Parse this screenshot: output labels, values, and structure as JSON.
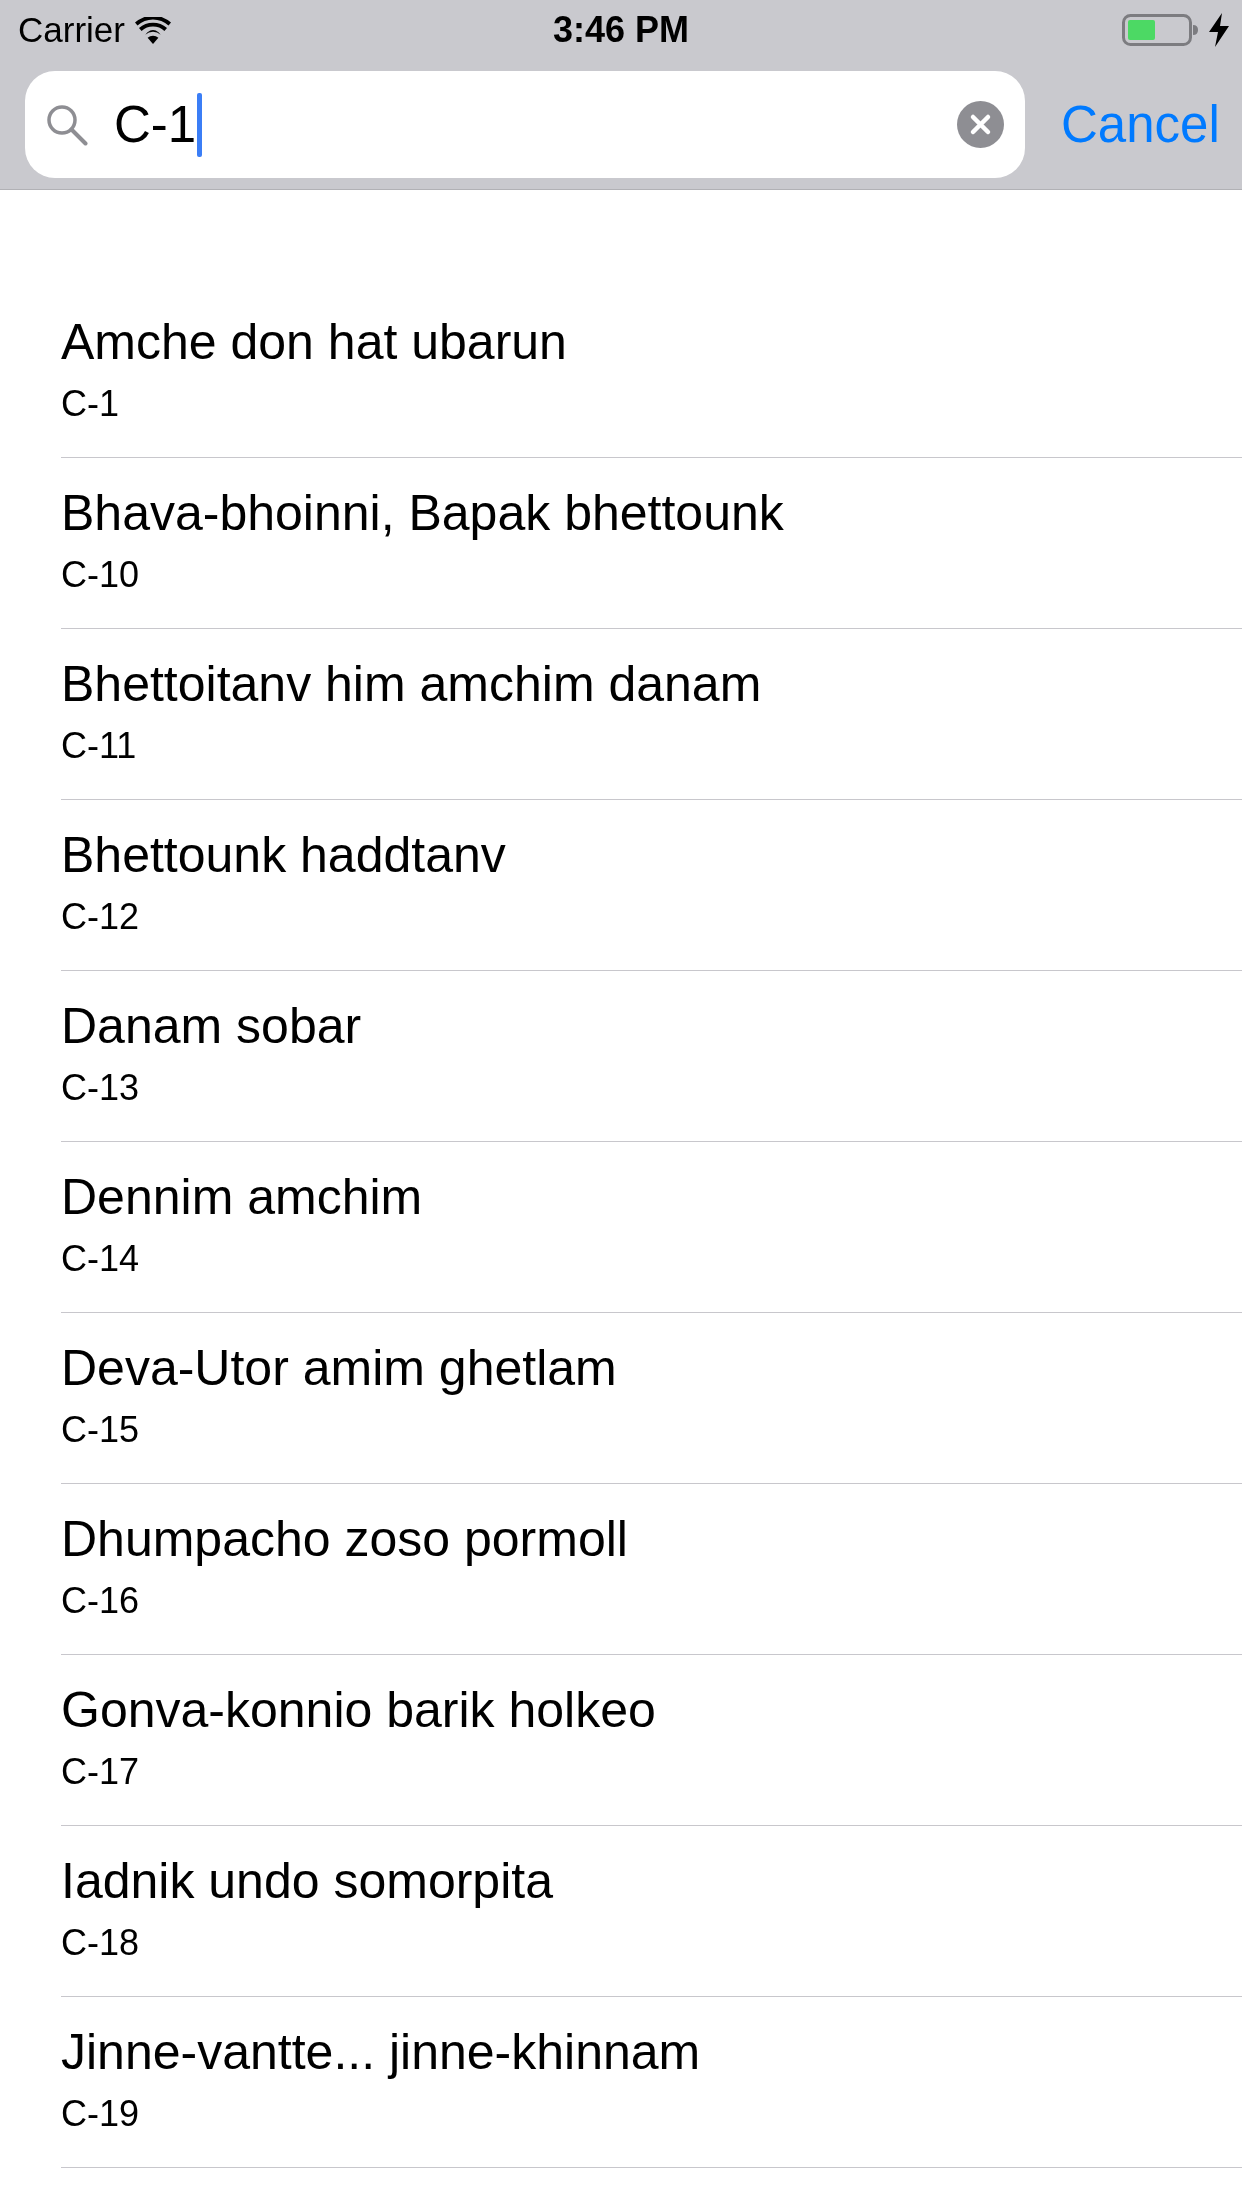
{
  "status_bar": {
    "carrier": "Carrier",
    "time": "3:46 PM"
  },
  "search": {
    "value": "C-1",
    "cancel_label": "Cancel"
  },
  "results": [
    {
      "title": "Amche don hat ubarun",
      "code": "C-1"
    },
    {
      "title": "Bhava-bhoinni, Bapak bhettounk",
      "code": "C-10"
    },
    {
      "title": "Bhettoitanv him amchim danam",
      "code": "C-11"
    },
    {
      "title": "Bhettounk haddtanv",
      "code": "C-12"
    },
    {
      "title": "Danam sobar",
      "code": "C-13"
    },
    {
      "title": "Dennim amchim",
      "code": "C-14"
    },
    {
      "title": "Deva-Utor amim ghetlam",
      "code": "C-15"
    },
    {
      "title": "Dhumpacho zoso pormoll",
      "code": "C-16"
    },
    {
      "title": "Gonva-konnio barik holkeo",
      "code": "C-17"
    },
    {
      "title": "Iadnik undo somorpita",
      "code": "C-18"
    },
    {
      "title": "Jinne-vantte... jinne-khinnam",
      "code": "C-19"
    }
  ]
}
